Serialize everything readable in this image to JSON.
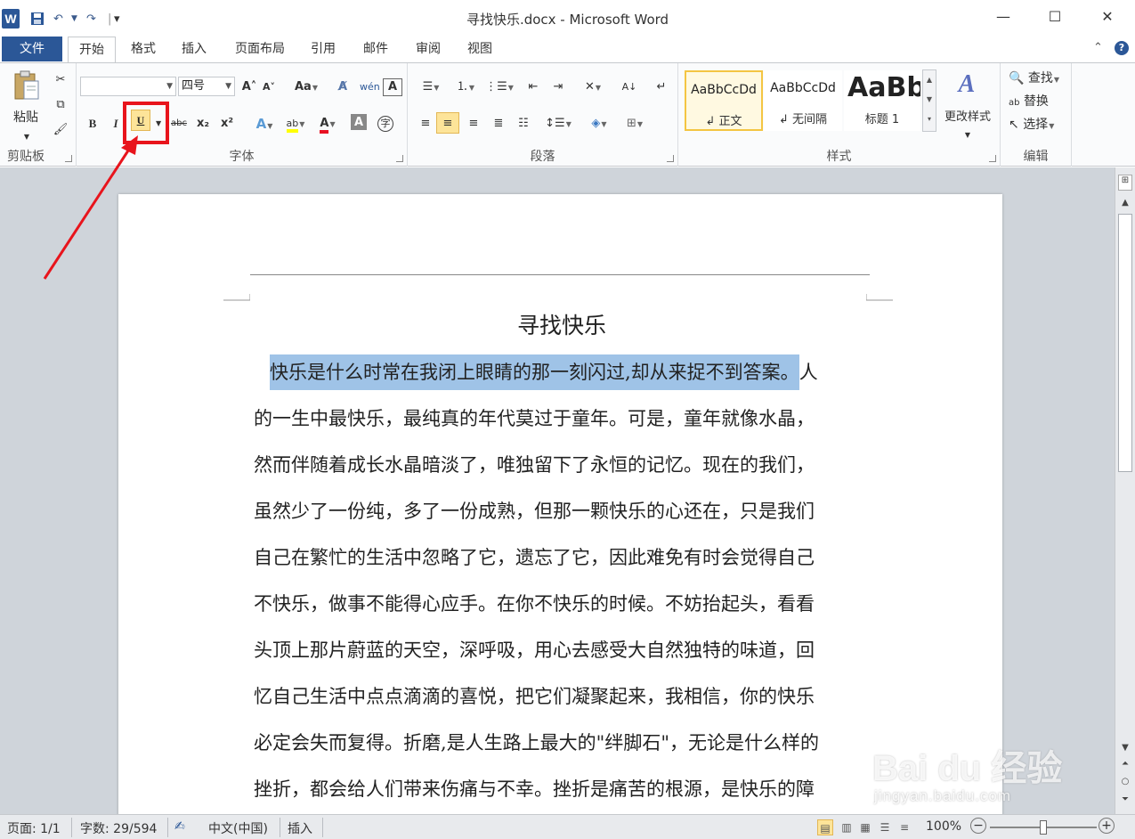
{
  "window": {
    "title": "寻找快乐.docx - Microsoft Word",
    "logo_letter": "W",
    "minimize": "—",
    "maximize": "☐",
    "close": "✕"
  },
  "qat": {
    "save": "💾",
    "undo": "↶",
    "redo": "↷",
    "customize": "▾"
  },
  "tabs": {
    "file": "文件",
    "items": [
      "开始",
      "格式",
      "插入",
      "页面布局",
      "引用",
      "邮件",
      "审阅",
      "视图"
    ],
    "active_index": 0
  },
  "ribbon": {
    "clipboard": {
      "label": "剪贴板",
      "paste": "粘贴"
    },
    "font": {
      "label": "字体",
      "font_name": "",
      "font_size": "四号",
      "grow": "A˄",
      "shrink": "A˅",
      "change_case": "Aa",
      "pinyin": "wén",
      "border_char": "A",
      "bold": "B",
      "italic": "I",
      "underline": "U",
      "strike": "abc",
      "subscript": "x₂",
      "superscript": "x²",
      "text_effect": "A",
      "highlight": "ab",
      "font_color": "A",
      "char_shading": "A",
      "enclose": "字"
    },
    "paragraph": {
      "label": "段落"
    },
    "styles": {
      "label": "样式",
      "items": [
        {
          "sample": "AaBbCcDd",
          "name": "↲ 正文"
        },
        {
          "sample": "AaBbCcDd",
          "name": "↲ 无间隔"
        },
        {
          "sample": "AaBb",
          "name": "标题 1"
        }
      ],
      "change_styles": "更改样式"
    },
    "editing": {
      "label": "编辑",
      "find": "查找",
      "replace": "替换",
      "select": "选择"
    }
  },
  "document": {
    "title": "寻找快乐",
    "selected_text": "快乐是什么时常在我闭上眼睛的那一刻闪过,却从来捉不到答案。",
    "first_line_rest": "人",
    "lines": [
      "的一生中最快乐，最纯真的年代莫过于童年。可是，童年就像水晶，",
      "然而伴随着成长水晶暗淡了，唯独留下了永恒的记忆。现在的我们，",
      "虽然少了一份纯，多了一份成熟，但那一颗快乐的心还在，只是我们",
      "自己在繁忙的生活中忽略了它，遗忘了它，因此难免有时会觉得自己",
      "不快乐，做事不能得心应手。在你不快乐的时候。不妨抬起头，看看",
      "头顶上那片蔚蓝的天空，深呼吸，用心去感受大自然独特的味道，回",
      "忆自己生活中点点滴滴的喜悦，把它们凝聚起来，我相信，你的快乐",
      "必定会失而复得。折磨,是人生路上最大的\"绊脚石\"，无论是什么样的",
      "挫折，都会给人们带来伤痛与不幸。挫折是痛苦的根源，是快乐的障"
    ]
  },
  "statusbar": {
    "page": "页面: 1/1",
    "words": "字数: 29/594",
    "language": "中文(中国)",
    "mode": "插入",
    "zoom": "100%",
    "zoom_minus": "−",
    "zoom_plus": "+",
    "zoom_level_fraction": 0.5
  },
  "watermark": {
    "brand": "Bai du 经验",
    "url": "jingyan.baidu.com"
  },
  "colors": {
    "accent": "#2b5797",
    "highlight_box": "#e8141c",
    "selection": "#9fc3e7"
  }
}
